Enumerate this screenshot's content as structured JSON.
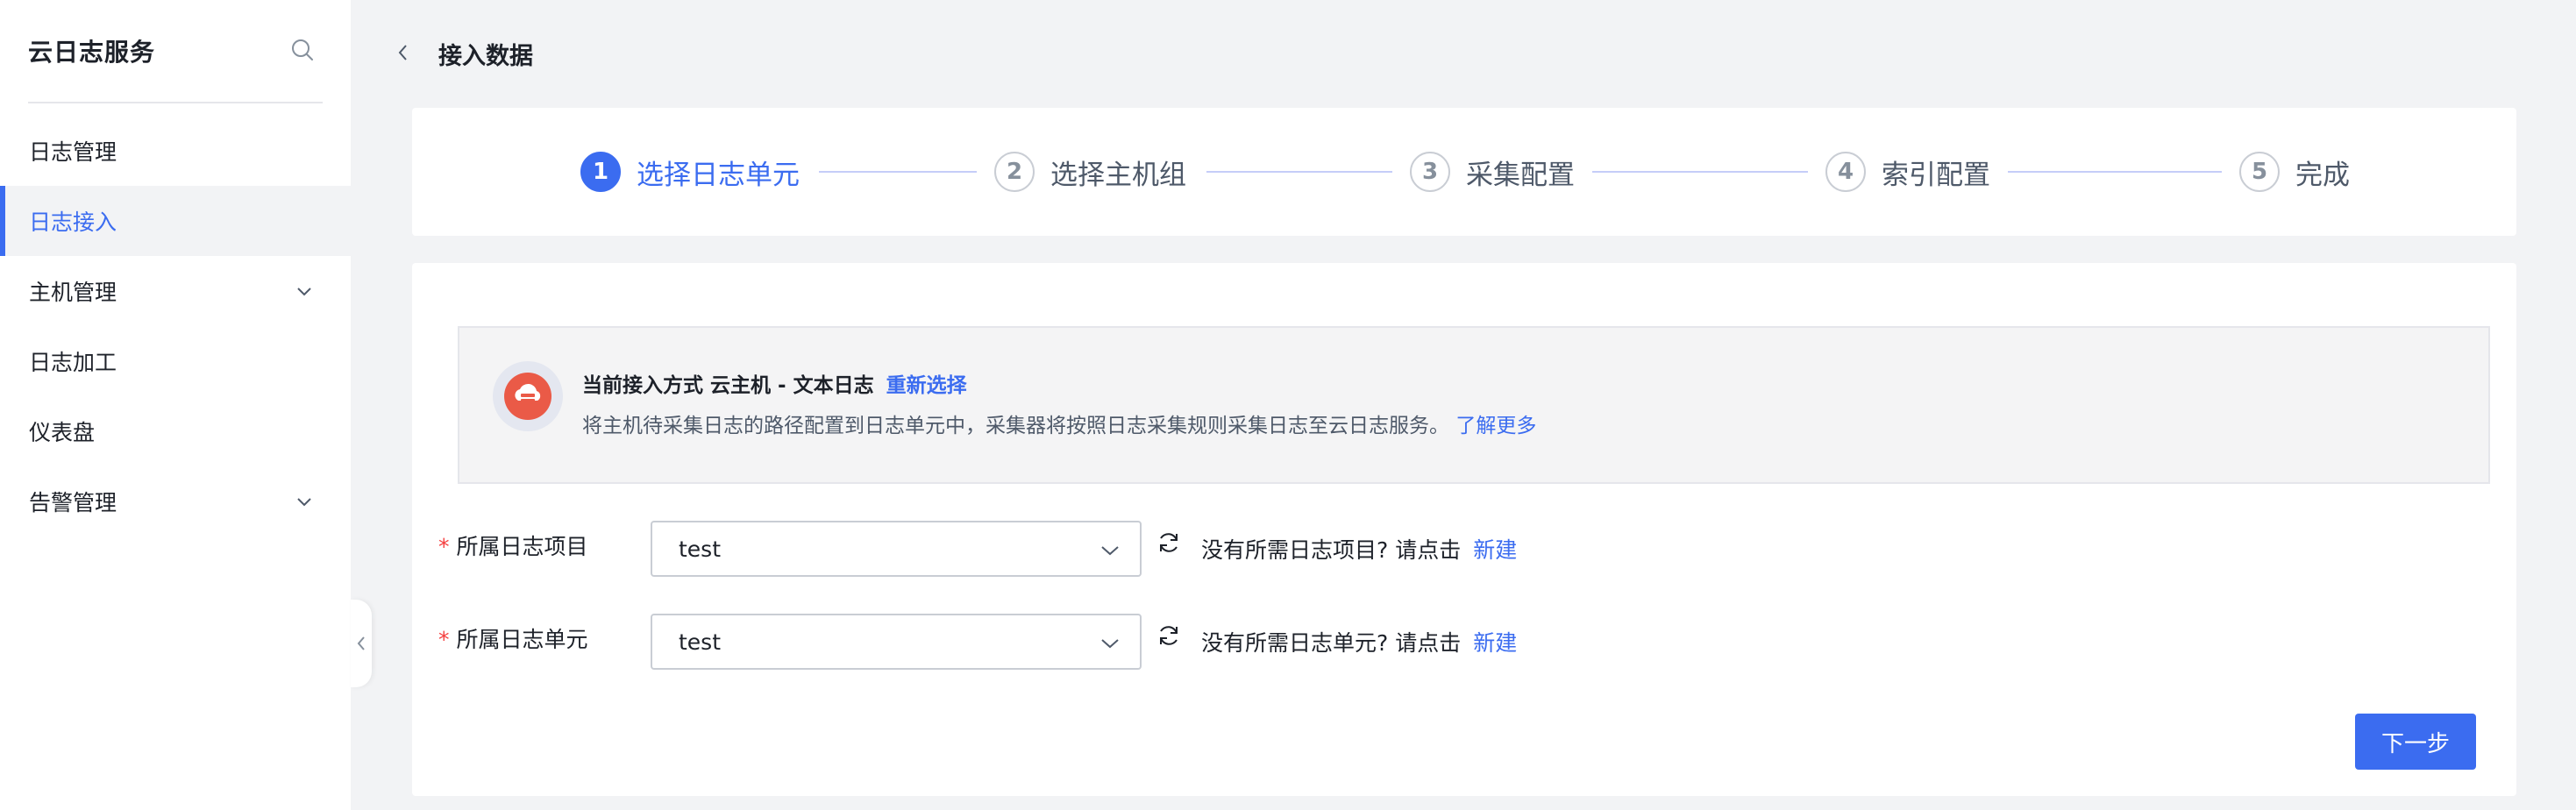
{
  "sidebar": {
    "title": "云日志服务",
    "items": [
      {
        "label": "日志管理"
      },
      {
        "label": "日志接入"
      },
      {
        "label": "主机管理"
      },
      {
        "label": "日志加工"
      },
      {
        "label": "仪表盘"
      },
      {
        "label": "告警管理"
      }
    ]
  },
  "header": {
    "title": "接入数据"
  },
  "steps": [
    {
      "num": "1",
      "label": "选择日志单元"
    },
    {
      "num": "2",
      "label": "选择主机组"
    },
    {
      "num": "3",
      "label": "采集配置"
    },
    {
      "num": "4",
      "label": "索引配置"
    },
    {
      "num": "5",
      "label": "完成"
    }
  ],
  "info": {
    "line1": "当前接入方式 云主机 - 文本日志",
    "reselect": "重新选择",
    "line2": "将主机待采集日志的路径配置到日志单元中，采集器将按照日志采集规则采集日志至云日志服务。",
    "learn_more": "了解更多"
  },
  "form": {
    "required_mark": "*",
    "project": {
      "label": "所属日志项目",
      "value": "test",
      "hint": "没有所需日志项目? 请点击",
      "create": "新建"
    },
    "unit": {
      "label": "所属日志单元",
      "value": "test",
      "hint": "没有所需日志单元? 请点击",
      "create": "新建"
    }
  },
  "next_button": "下一步",
  "colors": {
    "accent": "#3b6cf0",
    "icon": "#ea5a47",
    "required": "#f53f3f"
  },
  "icons": [
    "search-icon",
    "chevron-down-icon",
    "chevron-left-icon",
    "refresh-icon",
    "cloud-host-icon"
  ]
}
